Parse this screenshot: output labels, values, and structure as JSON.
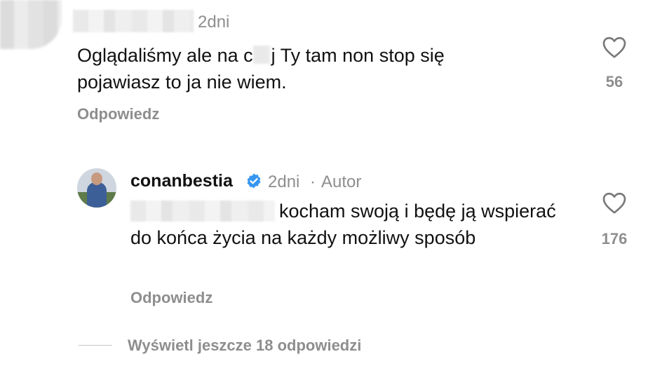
{
  "comment1": {
    "time": "2dni",
    "text": "Oglądaliśmy ale na c    j Ty tam non stop się pojawiasz to ja nie wiem.",
    "likes": "56",
    "reply_label": "Odpowiedz"
  },
  "comment2": {
    "username": "conanbestia",
    "verified": true,
    "time": "2dni",
    "separator": "·",
    "author_label": "Autor",
    "text": "kocham swoją i będę ją wspierać do końca życia na każdy możliwy sposób",
    "likes": "176",
    "reply_label": "Odpowiedz"
  },
  "more_replies": {
    "label": "Wyświetl jeszcze 18 odpowiedzi"
  },
  "colors": {
    "verified_blue": "#3797f0",
    "meta_gray": "#8e8e8e"
  }
}
